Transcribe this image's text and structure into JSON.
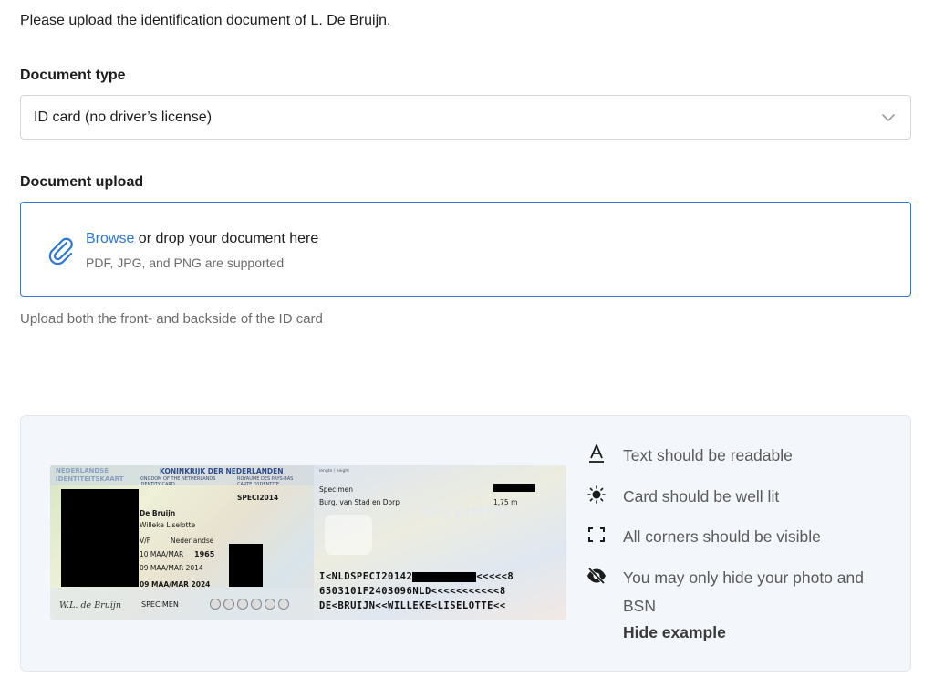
{
  "intro": "Please upload the identification document of L. De Bruijn.",
  "document_type": {
    "label": "Document type",
    "selected": "ID card (no driver’s license)",
    "icon": "chevron-down-icon"
  },
  "document_upload": {
    "label": "Document upload",
    "browse": "Browse",
    "drop_text": " or drop your document here",
    "supported": "PDF, JPG, and PNG are supported",
    "icon": "paperclip-icon",
    "helper": "Upload both the front- and backside of the ID card"
  },
  "example": {
    "front": {
      "country_left": "NEDERLANDSE",
      "card_type": "IDENTITEITSKAART",
      "kingdom": "KONINKRIJK DER NEDERLANDEN",
      "kingdom_en": "KINGDOM OF THE NETHERLANDS",
      "identity_card": "IDENTITY CARD",
      "kingdom_fr": "ROYAUME DES PAYS-BAS",
      "carte": "CARTE D'IDENTITE",
      "doc_number": "SPECI2014",
      "surname": "De Bruijn",
      "given_names": "Willeke Liselotte",
      "sex": "V/F",
      "nationality": "Nederlandse",
      "birth_date": "10 MAA/MAR",
      "birth_year": "1965",
      "issue_date": "09 MAA/MAR 2014",
      "expiry_date": "09 MAA/MAR 2024",
      "specimen": "SPECIMEN",
      "signature": "W.L. de Bruijn"
    },
    "back": {
      "height_label": "lengte / height",
      "name_label": "Specimen",
      "authority": "Burg. van Stad en Dorp",
      "height": "1,75 m",
      "watermark": "SPECIMEN",
      "mrz1_a": "I<NLDSPECI20142",
      "mrz1_b": "<<<<<8",
      "mrz2": "6503101F2403096NLD<<<<<<<<<<<8",
      "mrz3": "DE<BRUIJN<<WILLEKE<LISELOTTE<<"
    },
    "tips": [
      {
        "icon": "text-a-icon",
        "text": "Text should be readable"
      },
      {
        "icon": "sun-icon",
        "text": "Card should be well lit"
      },
      {
        "icon": "corners-icon",
        "text": "All corners should be visible"
      },
      {
        "icon": "eye-off-icon",
        "text": "You may only hide your photo and BSN"
      }
    ],
    "hide_label": "Hide example"
  },
  "colors": {
    "accent": "#2d77d8",
    "panel_bg": "#f3f6fa"
  }
}
